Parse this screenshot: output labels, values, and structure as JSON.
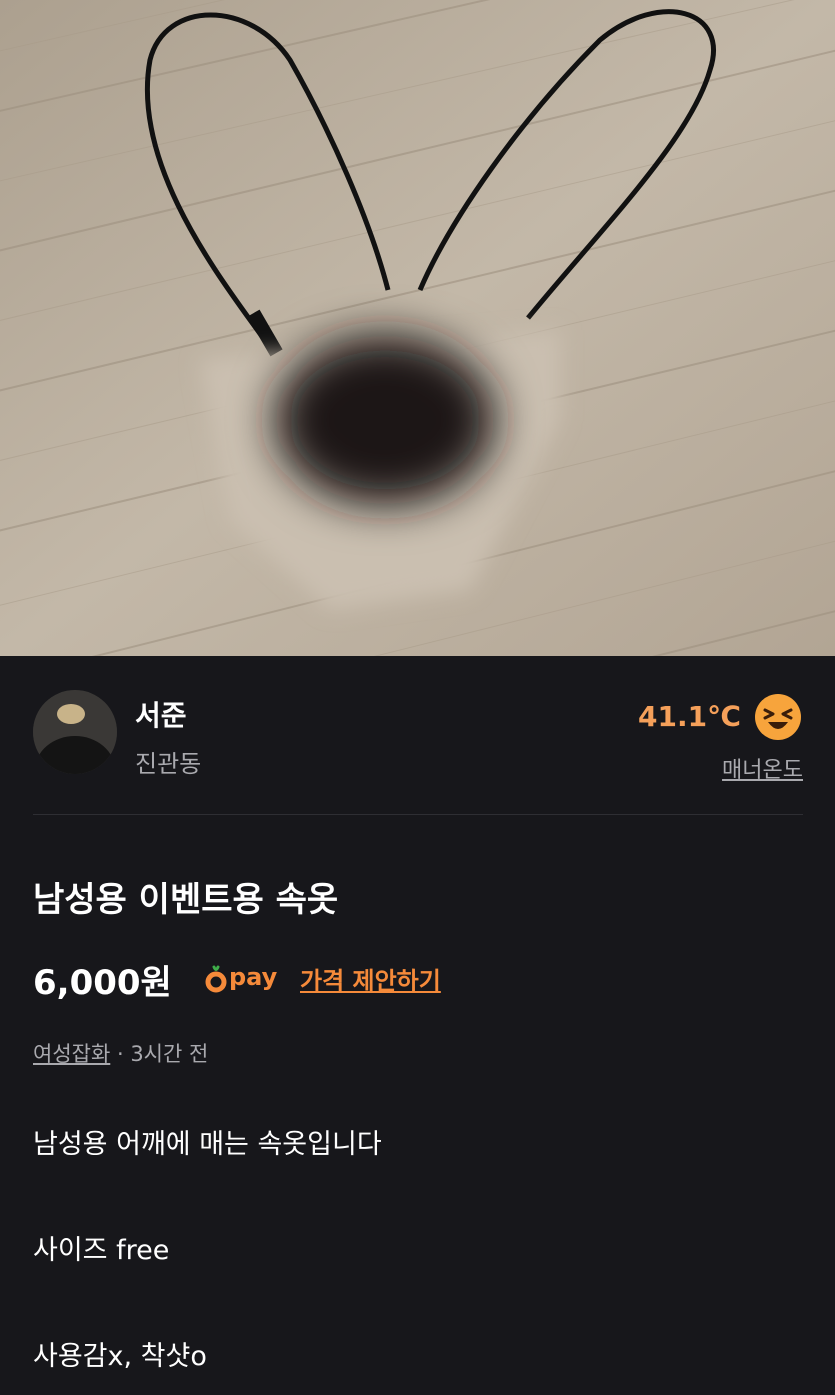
{
  "seller": {
    "name": "서준",
    "location": "진관동",
    "temperature": "41.1℃",
    "manner_label": "매너온도"
  },
  "product": {
    "title": "남성용 이벤트용 속옷",
    "price": "6,000원",
    "pay_label": "pay",
    "offer_label": "가격 제안하기",
    "category": "여성잡화",
    "meta_separator": " · ",
    "posted": "3시간 전",
    "description": [
      "남성용 어깨에 매는 속옷입니다",
      "사이즈 free",
      "사용감x, 착샷o"
    ]
  },
  "colors": {
    "background": "#17171b",
    "accent": "#f58a3a",
    "temperature": "#f5a05a",
    "muted_text": "#a9a9ae"
  },
  "icons": {
    "temperature_face": "laughing-face-icon",
    "pay_logo": "carrot-pay-icon"
  }
}
